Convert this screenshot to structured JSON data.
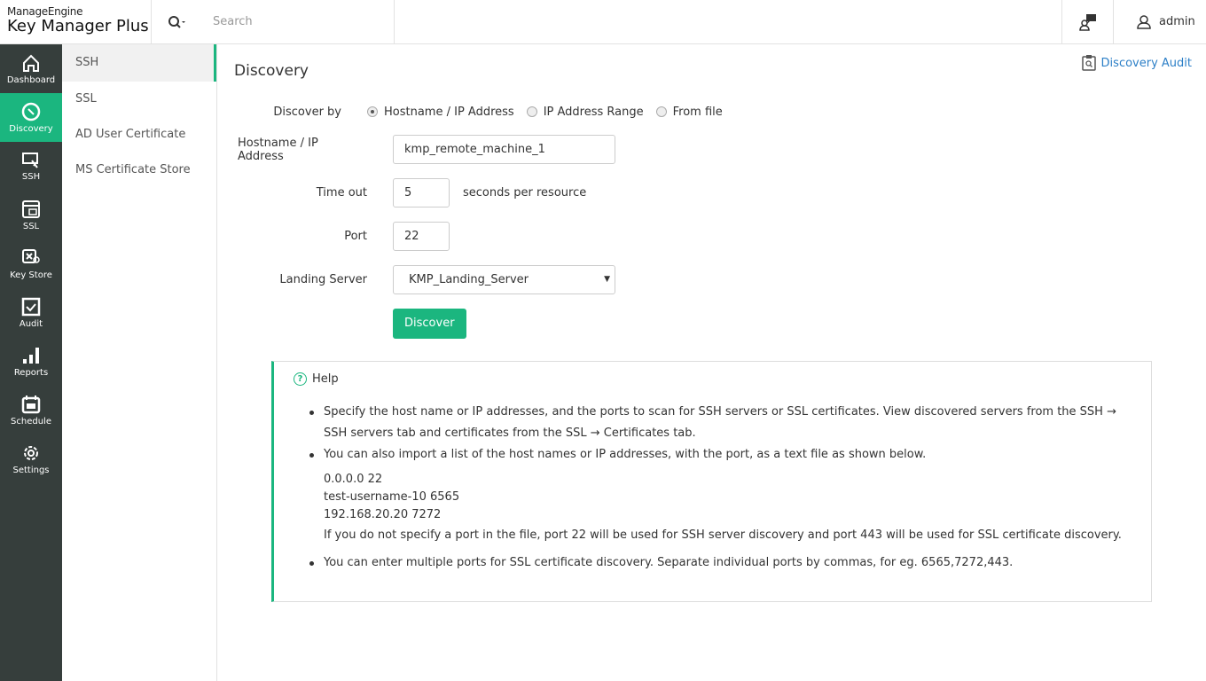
{
  "header": {
    "brand_top": "ManageEngine",
    "brand_product": "Key Manager Plus",
    "search_placeholder": "Search",
    "user": "admin"
  },
  "sidebar": [
    {
      "label": "Dashboard"
    },
    {
      "label": "Discovery"
    },
    {
      "label": "SSH"
    },
    {
      "label": "SSL"
    },
    {
      "label": "Key Store"
    },
    {
      "label": "Audit"
    },
    {
      "label": "Reports"
    },
    {
      "label": "Schedule"
    },
    {
      "label": "Settings"
    }
  ],
  "subnav": [
    "SSH",
    "SSL",
    "AD User Certificate",
    "MS Certificate Store"
  ],
  "main": {
    "title": "Discovery",
    "audit_link": "Discovery Audit",
    "discover_by_label": "Discover by",
    "options": [
      "Hostname / IP Address",
      "IP Address Range",
      "From file"
    ],
    "host_label": "Hostname / IP Address",
    "host_value": "kmp_remote_machine_1",
    "timeout_label": "Time out",
    "timeout_value": "5",
    "timeout_suffix": "seconds per resource",
    "port_label": "Port",
    "port_value": "22",
    "landing_label": "Landing Server",
    "landing_value": "KMP_Landing_Server",
    "discover_button": "Discover"
  },
  "help": {
    "title": "Help",
    "b1": "Specify the host name or IP addresses, and the ports to scan for SSH servers or SSL certificates. View discovered servers from the SSH → SSH servers tab and certificates from the SSL → Certificates tab.",
    "b2": "You can also import a list of the host names or IP addresses, with the port, as a text file as shown below.",
    "ex": [
      "0.0.0.0 22",
      "test-username-10 6565",
      "192.168.20.20 7272"
    ],
    "note": "If you do not specify a port in the file, port 22 will be used for SSH server discovery and port 443 will be used for SSL certificate discovery.",
    "b3": "You can enter multiple ports for SSL certificate discovery. Separate individual ports by commas, for eg. 6565,7272,443."
  },
  "colors": {
    "accent": "#1bb67f",
    "sidebar": "#363e3c",
    "link": "#2c7fc7"
  }
}
